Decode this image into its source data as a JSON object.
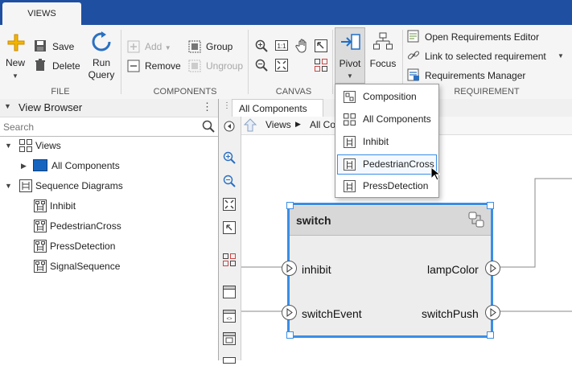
{
  "tabs": {
    "views": "VIEWS"
  },
  "ribbon": {
    "file": {
      "new": "New",
      "save": "Save",
      "delete": "Delete",
      "run_query": "Run\nQuery",
      "group": "FILE"
    },
    "components": {
      "add": "Add",
      "remove": "Remove",
      "group_btn": "Group",
      "ungroup": "Ungroup",
      "group": "COMPONENTS"
    },
    "canvas": {
      "group": "CANVAS"
    },
    "pivot": "Pivot",
    "focus": "Focus",
    "requirement": {
      "open_editor": "Open Requirements Editor",
      "link": "Link to selected requirement",
      "manager": "Requirements Manager",
      "group": "REQUIREMENT"
    }
  },
  "pivot_menu": {
    "items": [
      {
        "label": "Composition"
      },
      {
        "label": "All Components"
      },
      {
        "label": "Inhibit"
      },
      {
        "label": "PedestrianCross"
      },
      {
        "label": "PressDetection"
      }
    ]
  },
  "view_browser": {
    "title": "View Browser",
    "search_placeholder": "Search",
    "tree": {
      "views": "Views",
      "all_components": "All Components",
      "sequence_diagrams": "Sequence Diagrams",
      "inhibit": "Inhibit",
      "pedestrian_cross": "PedestrianCross",
      "press_detection": "PressDetection",
      "signal_sequence": "SignalSequence"
    }
  },
  "editor": {
    "tab": "All Components",
    "breadcrumb": {
      "root": "Views",
      "current": "All Co"
    }
  },
  "block": {
    "name": "switch",
    "ports_left": [
      "inhibit",
      "switchEvent"
    ],
    "ports_right": [
      "lampColor",
      "switchPush"
    ]
  },
  "colors": {
    "accent": "#1f4fa0",
    "selection": "#3a8ee6",
    "folder_blue": "#1565c0"
  }
}
